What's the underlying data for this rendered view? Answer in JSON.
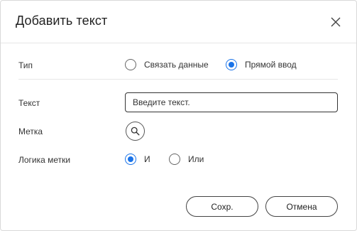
{
  "dialog": {
    "title": "Добавить текст",
    "close_icon": "close-icon"
  },
  "type_row": {
    "label": "Тип",
    "options": [
      {
        "label": "Связать данные",
        "checked": false
      },
      {
        "label": "Прямой ввод",
        "checked": true
      }
    ]
  },
  "text_row": {
    "label": "Текст",
    "placeholder": "Введите текст."
  },
  "tag_row": {
    "label": "Метка",
    "icon": "search-icon"
  },
  "logic_row": {
    "label": "Логика метки",
    "options": [
      {
        "label": "И",
        "checked": true
      },
      {
        "label": "Или",
        "checked": false
      }
    ]
  },
  "buttons": {
    "save": "Сохр.",
    "cancel": "Отмена"
  },
  "colors": {
    "accent": "#1a73e8",
    "border": "#d9d9d9",
    "text": "#333333"
  }
}
